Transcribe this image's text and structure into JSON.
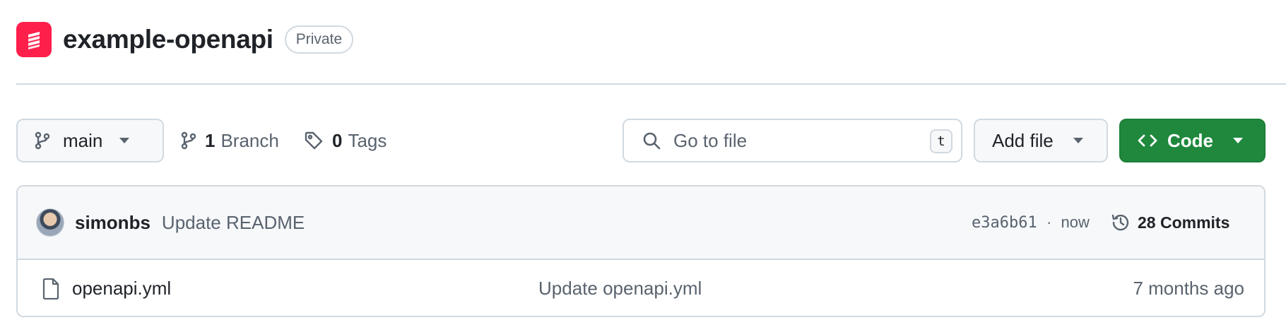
{
  "repo": {
    "name": "example-openapi",
    "visibility": "Private",
    "logo_icon": "layers-logo",
    "logo_color": "#ff1f4b"
  },
  "toolbar": {
    "branch_selector": "main",
    "branches_count": "1",
    "branches_label": "Branch",
    "tags_count": "0",
    "tags_label": "Tags",
    "search_placeholder": "Go to file",
    "search_shortcut": "t",
    "add_file_label": "Add file",
    "code_label": "Code",
    "code_button_color": "#1f883d"
  },
  "latest_commit": {
    "author": "simonbs",
    "message": "Update README",
    "sha": "e3a6b61",
    "separator": "·",
    "time": "now",
    "commits_label": "28 Commits"
  },
  "files": [
    {
      "icon": "file-icon",
      "name": "openapi.yml",
      "commit_message": "Update openapi.yml",
      "date": "7 months ago"
    }
  ]
}
